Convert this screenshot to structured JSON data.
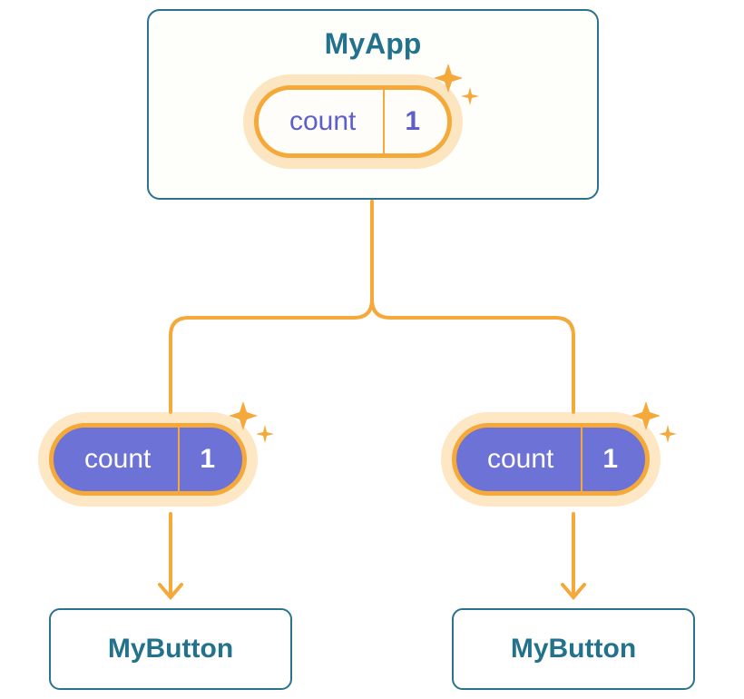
{
  "colors": {
    "teal": "#23728D",
    "orange": "#F4A93A",
    "orange_glow": "rgba(248,186,85,0.35)",
    "purple_text": "#5C5FCB",
    "purple_fill": "#6D72D6"
  },
  "parent": {
    "title": "MyApp",
    "state": {
      "label": "count",
      "value": "1"
    }
  },
  "props": {
    "left": {
      "label": "count",
      "value": "1"
    },
    "right": {
      "label": "count",
      "value": "1"
    }
  },
  "children": {
    "left": {
      "title": "MyButton"
    },
    "right": {
      "title": "MyButton"
    }
  }
}
